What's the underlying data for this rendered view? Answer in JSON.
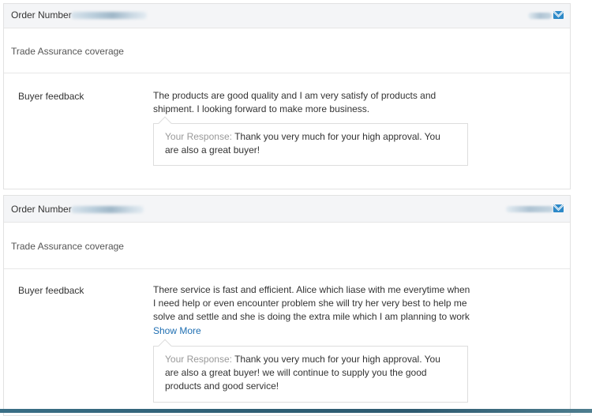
{
  "orders": [
    {
      "order_label": "Order Number",
      "trade_assurance": "Trade Assurance coverage",
      "feedback_label": "Buyer feedback",
      "feedback_text": "The products are good quality and I am very satisfy of products and shipment. I looking forward to make more business.",
      "response_label": "Your Response:",
      "response_text": "Thank you very much for your high approval. You are also a great buyer!",
      "icon": "mail-icon"
    },
    {
      "order_label": "Order Number",
      "trade_assurance": "Trade Assurance coverage",
      "feedback_label": "Buyer feedback",
      "feedback_text": "There service is fast and efficient. Alice which liase with me everytime when I need help or even encounter problem she will try her very best to help me solve and settle and she is doing the extra mile which I am planning to work",
      "show_more": "Show More",
      "response_label": "Your Response:",
      "response_text": "Thank you very much for your high approval. You are also a great buyer! we will continue to supply you the good products and good service!",
      "icon": "mail-icon"
    }
  ],
  "colors": {
    "link": "#1f6fb2",
    "mail_icon": "#2d89c8",
    "header_bg": "#f4f5f7"
  }
}
